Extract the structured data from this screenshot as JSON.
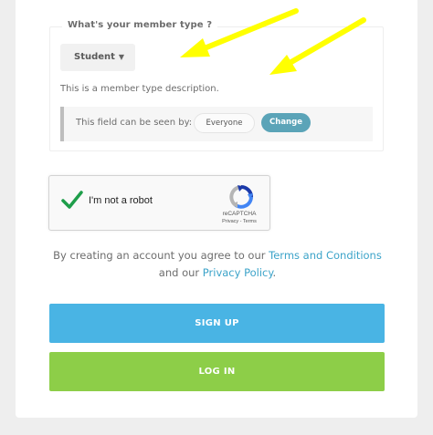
{
  "member_type": {
    "legend": "What's your member type ?",
    "selected": "Student",
    "description": "This is a member type description."
  },
  "visibility": {
    "label": "This field can be seen by:",
    "value": "Everyone",
    "change_label": "Change"
  },
  "captcha": {
    "label": "I'm not a robot",
    "brand": "reCAPTCHA",
    "privacy": "Privacy",
    "separator": " - ",
    "terms": "Terms",
    "checked": true
  },
  "agreement": {
    "text_before": "By creating an account you agree to our ",
    "terms_link": "Terms and Conditions",
    "text_middle": " and our ",
    "privacy_link": "Privacy Policy",
    "text_after": "."
  },
  "buttons": {
    "signup_label": "SIGN UP",
    "login_label": "LOG IN"
  },
  "colors": {
    "annotation_arrow": "#ffff00",
    "signup": "#49b4e4",
    "login": "#8dce48",
    "link": "#3ba3c9",
    "change_pill": "#5ba4b8"
  },
  "icons": {
    "captcha_check": "checkmark-icon",
    "captcha_logo": "recaptcha-logo-icon",
    "select_caret": "caret-down-icon"
  }
}
